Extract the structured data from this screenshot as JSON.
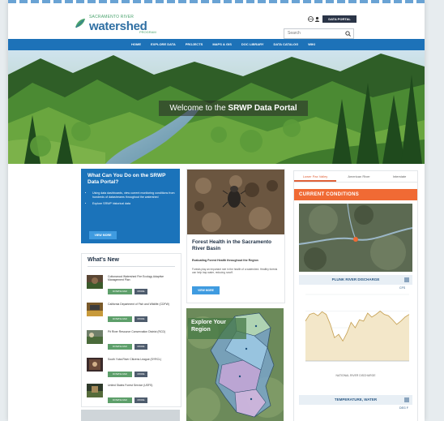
{
  "header": {
    "logo_tagline": "SACRAMENTO RIVER",
    "logo_name": "watershed",
    "logo_sub": "PROGRAM",
    "util_button": "DATA PORTAL",
    "search_placeholder": "Search"
  },
  "nav": {
    "items": [
      "HOME",
      "EXPLORE DATA",
      "PROJECTS",
      "MAPS & GIS",
      "DOC LIBRARY",
      "DATA CATALOG",
      "WIKI"
    ]
  },
  "hero": {
    "title_pre": "Welcome to the",
    "title_bold": "SRWP Data Portal"
  },
  "blue_card": {
    "title": "What Can You Do on the SRWP Data Portal?",
    "bullets": [
      "Using data dashboards, view current monitoring conditions from hundreds of datastreams throughout the watershed",
      "Explore SRWP historical data"
    ],
    "button": "VIEW MORE"
  },
  "whats_new": {
    "title": "What's New",
    "download_label": "DOWNLOAD",
    "more_label": "MORE",
    "items": [
      {
        "text": "Cottonwood Watershed Fire Ecology Adaptive Management Plan"
      },
      {
        "text": "California Department of Fish and Wildlife (CDFW)"
      },
      {
        "text": "Pit River Resource Conservation District (RCD)"
      },
      {
        "text": "South Yuba River Citizens League (SYRCL)"
      },
      {
        "text": "United States Forest Service (USFS)"
      }
    ]
  },
  "middle_card": {
    "title": "Forest Health in the Sacramento River Basin",
    "subtitle": "Evaluating Forest Health throughout the Region",
    "description": "Forests play an important role in the health of a watershed. Healthy forests can help trap water, reducing runoff.",
    "button": "VIEW MORE"
  },
  "map_card": {
    "title": "Explore Your Region"
  },
  "right_panel": {
    "tabs": [
      "Lower Pax Valley",
      "American River",
      "Interstate"
    ],
    "active_tab": 0,
    "conditions_title": "CURRENT CONDITIONS",
    "flow_title": "PLUNK RIVER DISCHARGE",
    "flow_unit": "CFS",
    "legend": "NATIONAL RIVER DISCHARGE",
    "temp_title": "TEMPERATURE, WATER",
    "temp_unit": "DEG F"
  },
  "chart_data": {
    "type": "area",
    "title": "PLUNK RIVER DISCHARGE",
    "xlabel": "",
    "ylabel": "CFS",
    "series": [
      {
        "name": "NATIONAL RIVER DISCHARGE",
        "values": [
          60,
          70,
          72,
          68,
          74,
          70,
          55,
          35,
          40,
          30,
          42,
          58,
          50,
          62,
          60,
          72,
          66,
          70,
          75,
          70,
          68,
          62,
          55,
          60,
          66,
          70
        ]
      }
    ]
  },
  "colors": {
    "nav_blue": "#1d72b8",
    "card_blue": "#1b73ba",
    "orange": "#f06a34",
    "green_button": "#5d9f6a"
  }
}
